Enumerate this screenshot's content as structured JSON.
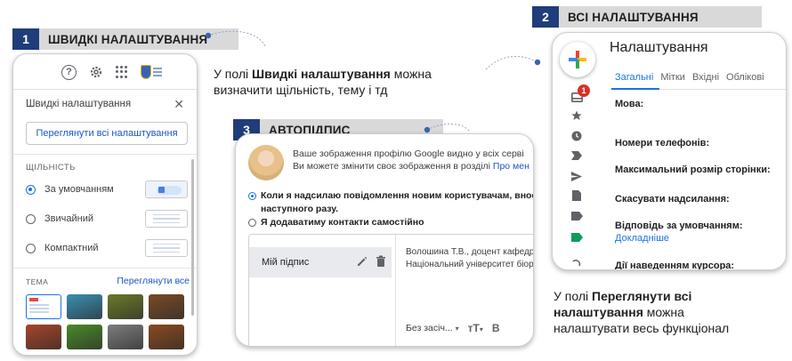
{
  "section1": {
    "number": "1",
    "title": "ШВИДКІ НАЛАШТУВАННЯ"
  },
  "section2": {
    "number": "2",
    "title": "ВСІ НАЛАШТУВАННЯ"
  },
  "section3": {
    "number": "3",
    "title": "АВТОПІДПИС"
  },
  "note_quick": {
    "line1_pre": "У полі ",
    "line1_bold": "Швидкі налаштування",
    "line1_post": " можна",
    "line2": "визначити щільність, тему і тд"
  },
  "note_all": {
    "line1_pre": "У полі ",
    "line1_bold": "Переглянути всі",
    "line2_bold": "налаштування",
    "line2_post": " можна",
    "line3": "налаштувати весь функціонал"
  },
  "quick_panel": {
    "title": "Швидкі налаштування",
    "close": "✕",
    "see_all_button": "Переглянути всі налаштування",
    "density_heading": "ЩІЛЬНІСТЬ",
    "density_options": [
      {
        "label": "За умовчанням",
        "selected": true
      },
      {
        "label": "Звичайний",
        "selected": false
      },
      {
        "label": "Компактний",
        "selected": false
      }
    ],
    "theme_heading": "ТЕМА",
    "theme_link": "Переглянути все",
    "help_icon": "?",
    "theme_colors": [
      "#ffffff",
      "#3a8fb3",
      "#6b7a2a",
      "#7a4a25",
      "#a8452a",
      "#4a8a2a",
      "#7d7d7d",
      "#8a4a20"
    ]
  },
  "signature_panel": {
    "info_line1": "Ваше зображення профілю Google видно у всіх серві",
    "info_line2_text": "Ви можете змінити своє зображення в розділі ",
    "info_line2_link": "Про мен",
    "option1_line1": "Коли я надсилаю повідомлення новим користувачам, вносити",
    "option1_line2": "наступного разу.",
    "option2": "Я додаватиму контакти самостійно",
    "signature_name": "Мій підпис",
    "signature_text_line1": "Волошина Т.В., доцент кафедри",
    "signature_text_line2": "Національний університет біоре",
    "font_selector": "Без засіч...",
    "text_size_icon": "тТ",
    "bold_button": "B",
    "caret": "▾"
  },
  "full_settings_panel": {
    "title": "Налаштування",
    "tabs": [
      "Загальні",
      "Мітки",
      "Вхідні",
      "Облікові"
    ],
    "unread_badge": "1",
    "rows": [
      "Мова:",
      "Номери телефонів:",
      "Максимальний розмір сторінки:",
      "Скасувати надсилання:",
      "Відповідь за умовчанням:",
      "Дії наведенням курсора:"
    ],
    "learn_more": "Докладніше"
  },
  "colors": {
    "section_number_bg": "#1f3d7a",
    "section_header_bg": "#d9d9d9",
    "link_blue": "#1a56c7",
    "active_tab": "#1a73e8",
    "badge_red": "#d93025",
    "label_green": "#0f9d58"
  }
}
